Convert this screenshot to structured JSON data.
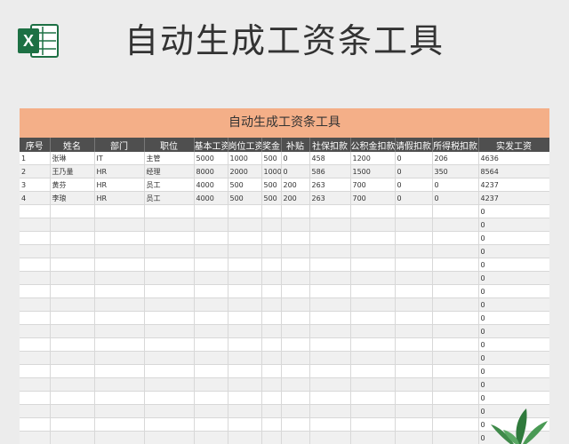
{
  "title": "自动生成工资条工具",
  "sheet_title": "自动生成工资条工具",
  "logo_letter": "X",
  "columns": [
    "序号",
    "姓名",
    "部门",
    "职位",
    "基本工资",
    "岗位工资",
    "奖金",
    "补贴",
    "社保扣款",
    "公积金扣款",
    "请假扣款",
    "所得税扣款",
    "实发工资"
  ],
  "rows": [
    [
      "1",
      "张琳",
      "IT",
      "主管",
      "5000",
      "1000",
      "500",
      "0",
      "458",
      "1200",
      "0",
      "206",
      "4636"
    ],
    [
      "2",
      "王乃量",
      "HR",
      "经理",
      "8000",
      "2000",
      "1000",
      "0",
      "586",
      "1500",
      "0",
      "350",
      "8564"
    ],
    [
      "3",
      "黄芬",
      "HR",
      "员工",
      "4000",
      "500",
      "500",
      "200",
      "263",
      "700",
      "0",
      "0",
      "4237"
    ],
    [
      "4",
      "李琅",
      "HR",
      "员工",
      "4000",
      "500",
      "500",
      "200",
      "263",
      "700",
      "0",
      "0",
      "4237"
    ]
  ],
  "empty_row_salary": "0",
  "colors": {
    "header_bar": "#f4af88",
    "column_header": "#4f4f4f",
    "excel_green": "#1d7044"
  }
}
